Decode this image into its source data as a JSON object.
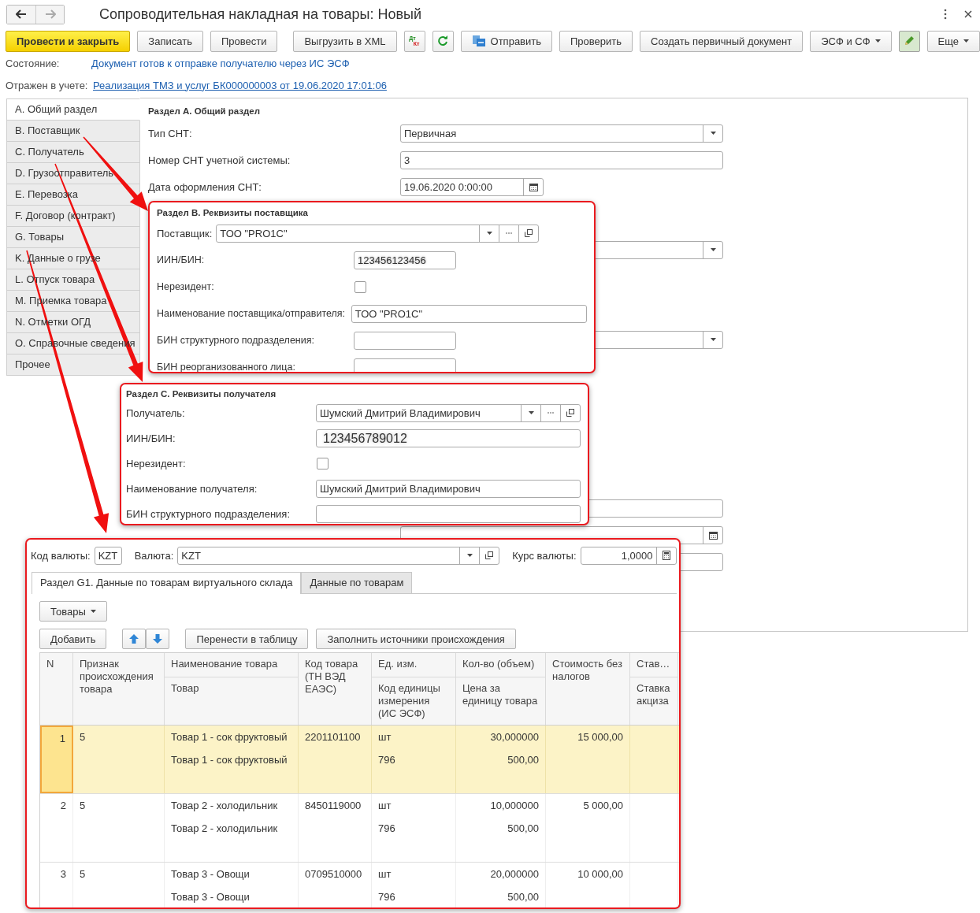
{
  "window": {
    "title": "Сопроводительная накладная на товары: Новый"
  },
  "toolbar": [
    {
      "kind": "primary",
      "label": "Провести и закрыть"
    },
    {
      "kind": "text",
      "label": "Записать"
    },
    {
      "kind": "text",
      "label": "Провести"
    },
    {
      "kind": "text",
      "label": "Выгрузить в XML"
    },
    {
      "kind": "dtkt",
      "top": "Дт",
      "bottom": "Кт"
    },
    {
      "kind": "refresh"
    },
    {
      "kind": "send",
      "label": "Отправить"
    },
    {
      "kind": "text",
      "label": "Проверить"
    },
    {
      "kind": "text",
      "label": "Создать первичный документ"
    },
    {
      "kind": "dropdown",
      "label": "ЭСФ и СФ"
    },
    {
      "kind": "edit",
      "pressed": true
    },
    {
      "kind": "dropdown",
      "label": "Еще"
    }
  ],
  "status": {
    "label": "Состояние:",
    "value": "Документ готов к отправке получателю через ИС ЭСФ"
  },
  "posted": {
    "label": "Отражен в учете:",
    "link": "Реализация ТМЗ и услуг БК000000003 от 19.06.2020 17:01:06"
  },
  "sections": [
    {
      "label": "A. Общий раздел",
      "selected": true
    },
    {
      "label": "B. Поставщик",
      "selected": false
    },
    {
      "label": "C. Получатель",
      "selected": false
    },
    {
      "label": "D. Грузоотправитель",
      "selected": false
    },
    {
      "label": "E. Перевозка",
      "selected": false
    },
    {
      "label": "F. Договор (контракт)",
      "selected": false
    },
    {
      "label": "G. Товары",
      "selected": false
    },
    {
      "label": "K. Данные о грузе",
      "selected": false
    },
    {
      "label": "L. Отпуск товара",
      "selected": false
    },
    {
      "label": "M. Приемка товара",
      "selected": false
    },
    {
      "label": "N. Отметки ОГД",
      "selected": false
    },
    {
      "label": "O. Справочные сведения",
      "selected": false
    },
    {
      "label": "Прочее",
      "selected": false
    }
  ],
  "form": {
    "title": "Раздел А. Общий раздел",
    "rows": [
      {
        "kind": "select",
        "label": "Тип СНТ:",
        "value": "Первичная"
      },
      {
        "kind": "text",
        "label": "Номер СНТ учетной системы:",
        "value": "3"
      },
      {
        "kind": "date",
        "label": "Дата оформления СНТ:",
        "value": "19.06.2020  0:00:00"
      },
      {
        "kind": "select"
      },
      {
        "kind": "select"
      },
      {
        "kind": "text"
      },
      {
        "kind": "datewide"
      },
      {
        "kind": "text"
      }
    ]
  },
  "supplier_panel": {
    "title": "Раздел B. Реквизиты поставщика",
    "rows": [
      {
        "kind": "ref-inline",
        "label": "Поставщик:",
        "value": "ТОО \"PRO1C\""
      },
      {
        "kind": "short",
        "label": "ИИН/БИН:",
        "value": "123456123456"
      },
      {
        "kind": "checkbox",
        "label": "Нерезидент:",
        "checked": false
      },
      {
        "kind": "wide",
        "label": "Наименование поставщика/отправителя:",
        "value": "ТОО \"PRO1C\""
      },
      {
        "kind": "short",
        "label": "БИН структурного подразделения:"
      },
      {
        "kind": "short",
        "label": "БИН реорганизованного лица:"
      }
    ]
  },
  "recipient_panel": {
    "title": "Раздел C. Реквизиты получателя",
    "rows": [
      {
        "kind": "ref",
        "label": "Получатель:",
        "value": "Шумский Дмитрий Владимирович"
      },
      {
        "kind": "big",
        "label": "ИИН/БИН:",
        "value": "123456789012"
      },
      {
        "kind": "checkbox",
        "label": "Нерезидент:",
        "checked": false
      },
      {
        "kind": "wide",
        "label": "Наименование получателя:",
        "value": "Шумский Дмитрий Владимирович"
      },
      {
        "kind": "wide",
        "label": "БИН структурного подразделения:"
      }
    ]
  },
  "goods_panel": {
    "currency_code_label": "Код валюты:",
    "currency_code": "KZT",
    "currency_label": "Валюта:",
    "currency": "KZT",
    "rate_label": "Курс валюты:",
    "rate": "1,0000",
    "tabs": [
      {
        "label": "Раздел G1. Данные по товарам виртуального склада",
        "selected": true
      },
      {
        "label": "Данные по товарам",
        "selected": false
      }
    ],
    "menu": "Товары",
    "buttons": [
      {
        "kind": "text",
        "label": "Добавить"
      },
      {
        "kind": "arrows"
      },
      {
        "kind": "text",
        "label": "Перенести в таблицу"
      },
      {
        "kind": "text",
        "label": "Заполнить источники происхождения"
      }
    ],
    "table": {
      "columns": [
        {
          "label": "N"
        },
        {
          "label": "Признак происхождения товара"
        },
        {
          "label": "Наименование товара",
          "sublabel": "Товар"
        },
        {
          "label": "Код товара (ТН ВЭД ЕАЭС)"
        },
        {
          "label": "Ед. изм.",
          "sublabel": "Код единицы измерения (ИС ЭСФ)"
        },
        {
          "label": "Кол-во (объем)",
          "sublabel": "Цена за единицу товара"
        },
        {
          "label": "Стоимость без налогов"
        },
        {
          "label": "Став…",
          "sublabel": "Ставка акциза"
        }
      ],
      "rows": [
        {
          "selected": true,
          "n": "1",
          "origin": "5",
          "name": "Товар 1 - сок фруктовый",
          "product": "Товар 1 - сок фруктовый",
          "code": "2201101100",
          "unit": "шт",
          "unit_code": "796",
          "quantity": "30,000000",
          "price": "500,00",
          "cost": "15 000,00"
        },
        {
          "selected": false,
          "n": "2",
          "origin": "5",
          "name": "Товар 2 - холодильник",
          "product": "Товар 2 - холодильник",
          "code": "8450119000",
          "unit": "шт",
          "unit_code": "796",
          "quantity": "10,000000",
          "price": "500,00",
          "cost": "5 000,00"
        },
        {
          "selected": false,
          "n": "3",
          "origin": "5",
          "name": "Товар 3 - Овощи",
          "product": "Товар 3 - Овощи",
          "code": "0709510000",
          "unit": "шт",
          "unit_code": "796",
          "quantity": "20,000000",
          "price": "500,00",
          "cost": "10 000,00"
        }
      ]
    }
  }
}
